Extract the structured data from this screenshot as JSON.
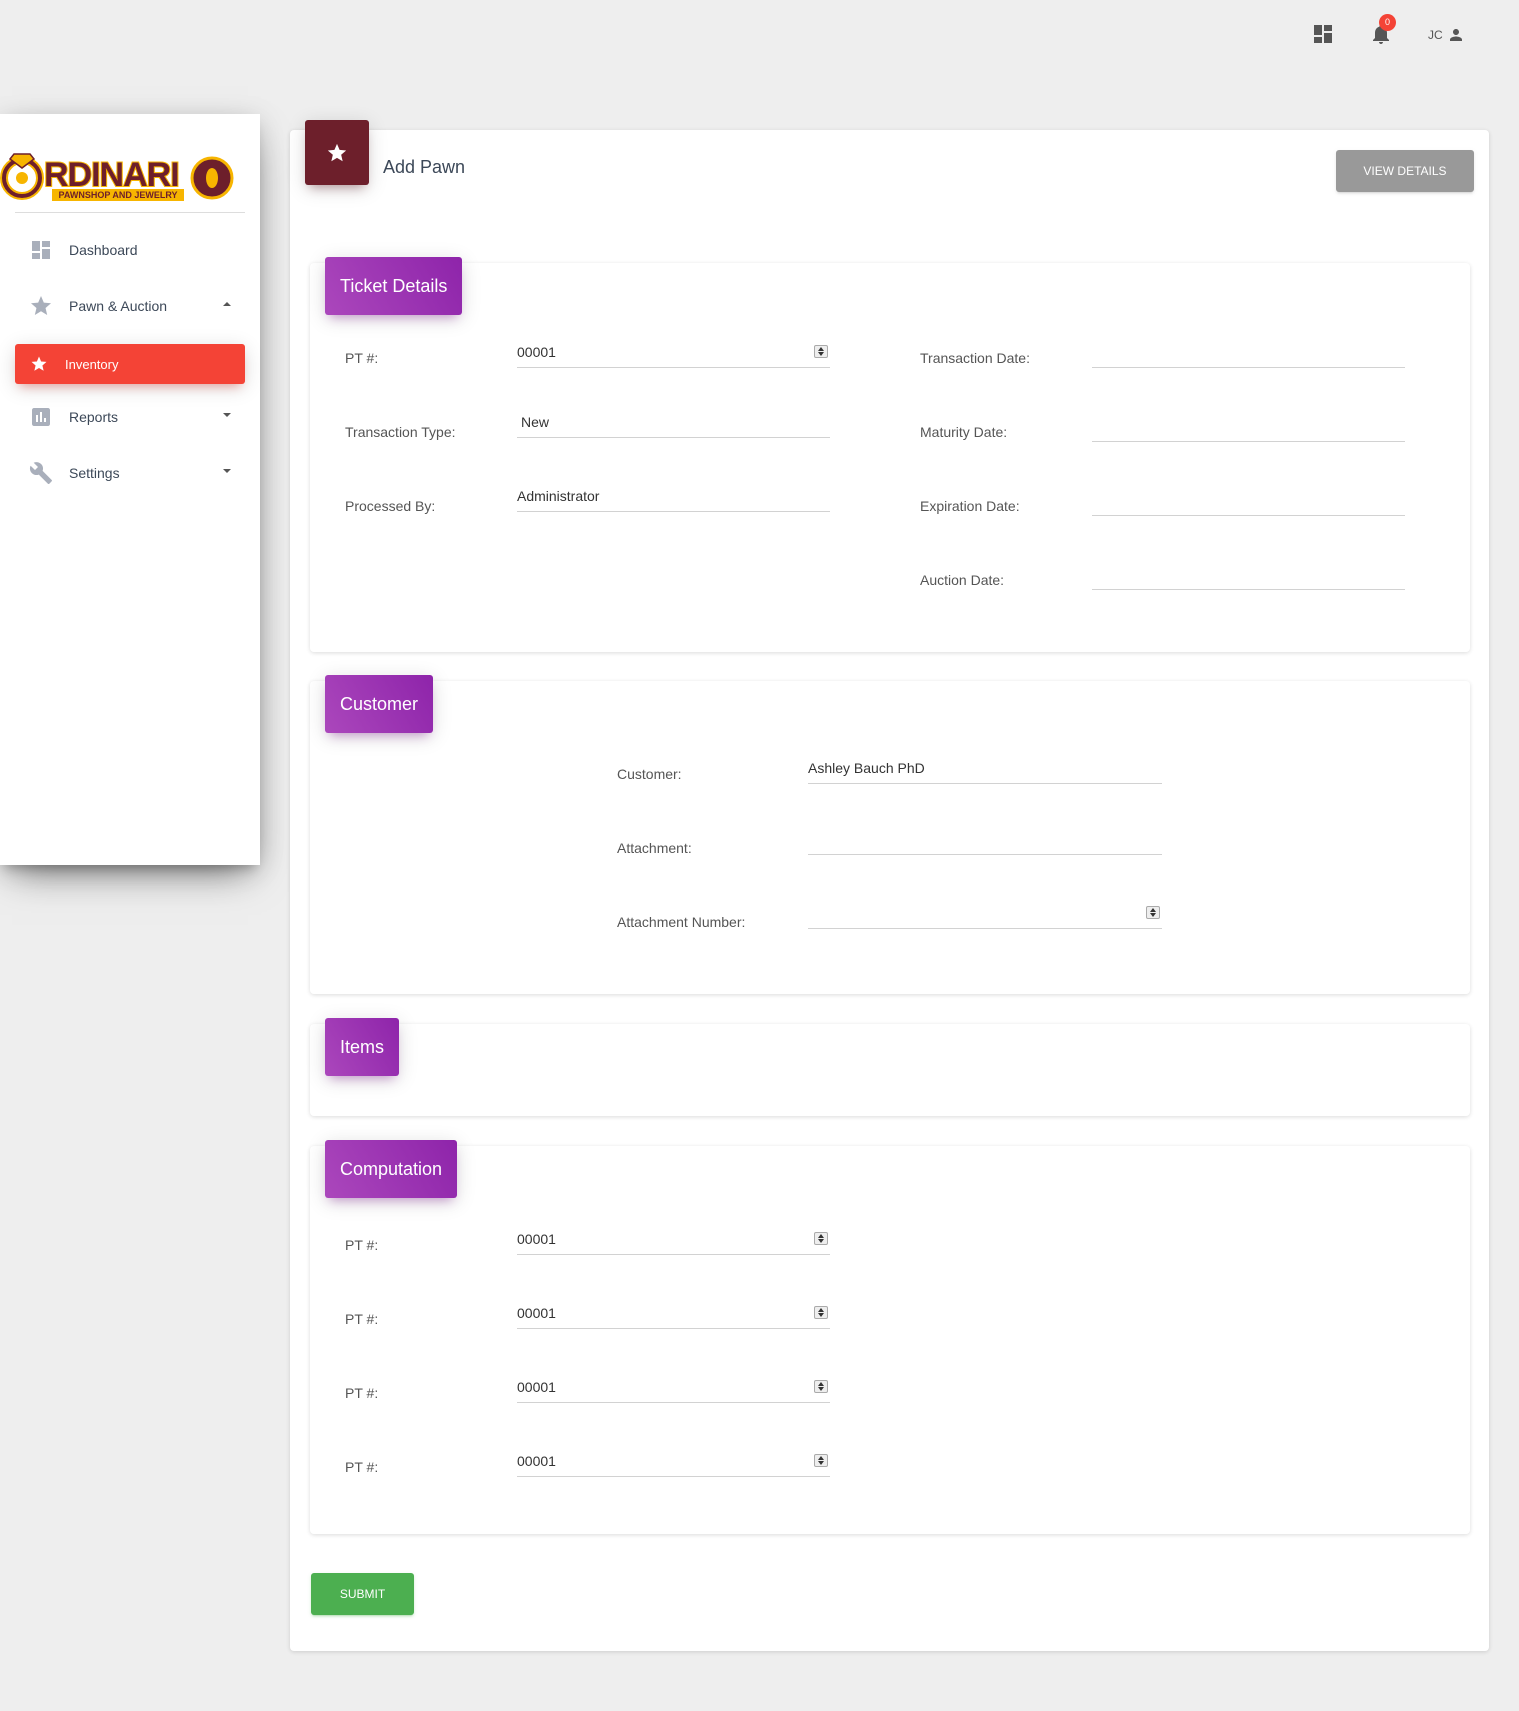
{
  "topbar": {
    "apps_icon": "dashboard-grid-icon",
    "notifications_icon": "bell-icon",
    "notification_count": "0",
    "user_initials": "JC",
    "user_icon": "person-icon"
  },
  "sidebar": {
    "logo": {
      "name": "RDINARI",
      "tagline": "PAWNSHOP AND JEWELRY",
      "colors": {
        "primary": "#6d1f2b",
        "accent": "#f7b500"
      }
    },
    "items": [
      {
        "label": "Dashboard",
        "icon": "dashboard-icon"
      },
      {
        "label": "Pawn & Auction",
        "icon": "star-icon",
        "expanded": true
      },
      {
        "label": "Inventory",
        "icon": "star-icon",
        "active": true
      },
      {
        "label": "Reports",
        "icon": "bar-chart-icon"
      },
      {
        "label": "Settings",
        "icon": "wrench-icon"
      }
    ]
  },
  "page": {
    "header_icon": "star-icon",
    "header_color": "#6d1f2b",
    "title": "Add Pawn",
    "view_details_label": "VIEW DETAILS"
  },
  "ticket_details": {
    "title": "Ticket Details",
    "pt_label": "PT #:",
    "pt_value": "00001",
    "transaction_type_label": "Transaction Type:",
    "transaction_type_value": "New",
    "processed_by_label": "Processed By:",
    "processed_by_value": "Administrator",
    "transaction_date_label": "Transaction Date:",
    "transaction_date_value": "",
    "maturity_date_label": "Maturity Date:",
    "maturity_date_value": "",
    "expiration_date_label": "Expiration Date:",
    "expiration_date_value": "",
    "auction_date_label": "Auction Date:",
    "auction_date_value": ""
  },
  "customer": {
    "title": "Customer",
    "customer_label": "Customer:",
    "customer_value": "Ashley Bauch PhD",
    "attachment_label": "Attachment:",
    "attachment_value": "",
    "attachment_number_label": "Attachment Number:",
    "attachment_number_value": ""
  },
  "items": {
    "title": "Items"
  },
  "computation": {
    "title": "Computation",
    "rows": [
      {
        "label": "PT #:",
        "value": "00001"
      },
      {
        "label": "PT #:",
        "value": "00001"
      },
      {
        "label": "PT #:",
        "value": "00001"
      },
      {
        "label": "PT #:",
        "value": "00001"
      }
    ]
  },
  "submit_label": "SUBMIT",
  "colors": {
    "active_nav": "#f44336",
    "section_tab": "#9c27b0",
    "submit": "#4caf50",
    "view_details": "#999999"
  }
}
